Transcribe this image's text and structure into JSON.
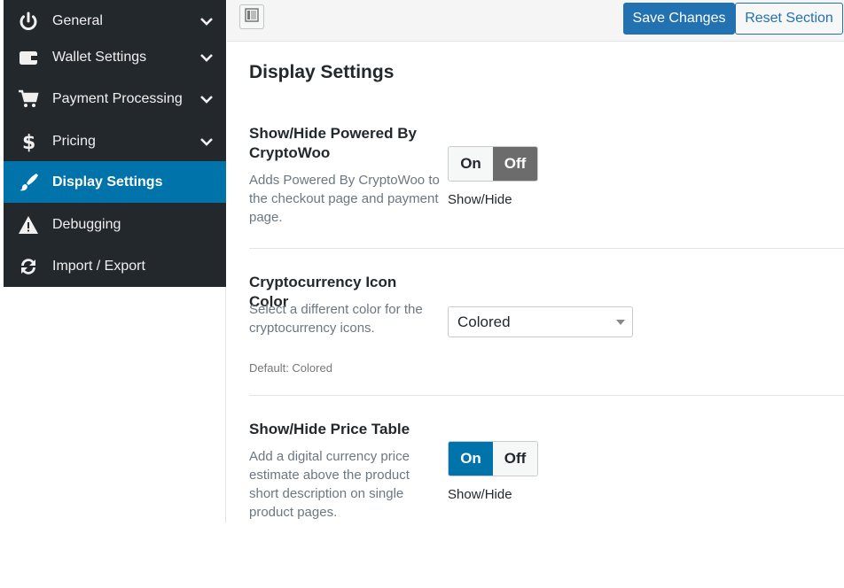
{
  "sidebar": {
    "items": [
      {
        "label": "General",
        "icon": "power-icon",
        "has_submenu": true,
        "active": false
      },
      {
        "label": "Wallet Settings",
        "icon": "wallet-icon",
        "has_submenu": true,
        "active": false
      },
      {
        "label": "Payment Processing",
        "icon": "cart-icon",
        "has_submenu": true,
        "active": false
      },
      {
        "label": "Pricing",
        "icon": "dollar-icon",
        "has_submenu": true,
        "active": false
      },
      {
        "label": "Display Settings",
        "icon": "brush-icon",
        "has_submenu": false,
        "active": true
      },
      {
        "label": "Debugging",
        "icon": "warning-icon",
        "has_submenu": false,
        "active": false
      },
      {
        "label": "Import / Export",
        "icon": "refresh-icon",
        "has_submenu": false,
        "active": false
      }
    ]
  },
  "toolbar": {
    "save_label": "Save Changes",
    "reset_label": "Reset Section"
  },
  "main": {
    "section_title": "Display Settings",
    "fields": [
      {
        "title": "Show/Hide Powered By CryptoWoo",
        "description": "Adds Powered By CryptoWoo to the checkout page and payment page.",
        "control": "switch",
        "on_label": "On",
        "off_label": "Off",
        "value": "Off",
        "caption": "Show/Hide"
      },
      {
        "title": "Cryptocurrency Icon Color",
        "description": "Select a different color for the cryptocurrency icons.",
        "control": "select",
        "value": "Colored",
        "default_text": "Default: Colored"
      },
      {
        "title": "Show/Hide Price Table",
        "description": "Add a digital currency price estimate above the product short description on single product pages.",
        "control": "switch",
        "on_label": "On",
        "off_label": "Off",
        "value": "On",
        "caption": "Show/Hide"
      }
    ]
  },
  "colors": {
    "sidebar_bg": "#23282d",
    "active_item": "#0073aa",
    "primary_button": "#2271b1"
  }
}
